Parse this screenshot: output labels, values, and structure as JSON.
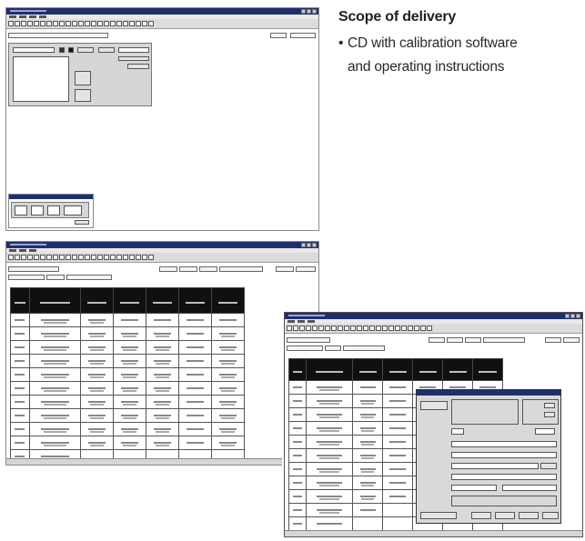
{
  "scope": {
    "title": "Scope of delivery",
    "bullet": "•",
    "item_line1": "CD with calibration software",
    "item_line2": "and operating instructions"
  },
  "colors": {
    "titlebar": "#1e2f6e",
    "table_header": "#101010",
    "text": "#1f1f1f"
  },
  "screenshots": [
    {
      "name": "calibration-window-start",
      "table_rows": 0
    },
    {
      "name": "calibration-window-table",
      "table_rows": 11
    },
    {
      "name": "calibration-window-dialog",
      "table_rows": 11
    }
  ]
}
